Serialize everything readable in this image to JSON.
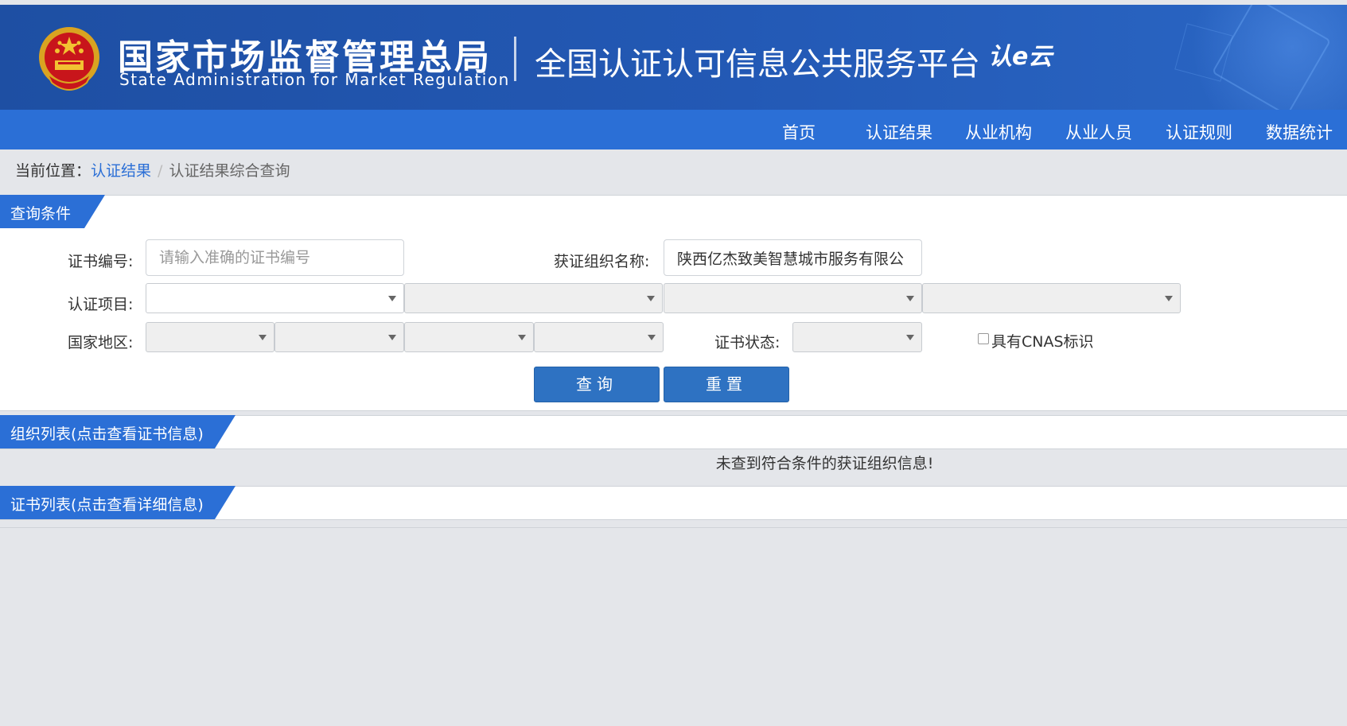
{
  "header": {
    "agency_cn": "国家市场监督管理总局",
    "agency_en": "State Administration  for  Market Regulation",
    "platform_title": "全国认证认可信息公共服务平台",
    "platform_logo": "认e云"
  },
  "nav": {
    "items": [
      "首页",
      "认证结果",
      "从业机构",
      "从业人员",
      "认证规则",
      "数据统计"
    ]
  },
  "breadcrumb": {
    "prefix": "当前位置：",
    "link": "认证结果",
    "separator": "/",
    "current": "认证结果综合查询"
  },
  "query_panel": {
    "title": "查询条件",
    "cert_no_label": "证书编号:",
    "cert_no_placeholder": "请输入准确的证书编号",
    "org_name_label": "获证组织名称:",
    "org_name_value": "陕西亿杰致美智慧城市服务有限公",
    "project_label": "认证项目:",
    "region_label": "国家地区:",
    "status_label": "证书状态:",
    "cnas_label": "具有CNAS标识",
    "query_button": "查询",
    "reset_button": "重置"
  },
  "org_list": {
    "title": "组织列表(点击查看证书信息)",
    "empty_message": "未查到符合条件的获证组织信息!"
  },
  "cert_list": {
    "title": "证书列表(点击查看详细信息)"
  },
  "colors": {
    "header_bg": "#2359b5",
    "nav_bg": "#2b6fd6",
    "button_bg": "#2e72c2",
    "page_bg": "#e4e6ea"
  }
}
